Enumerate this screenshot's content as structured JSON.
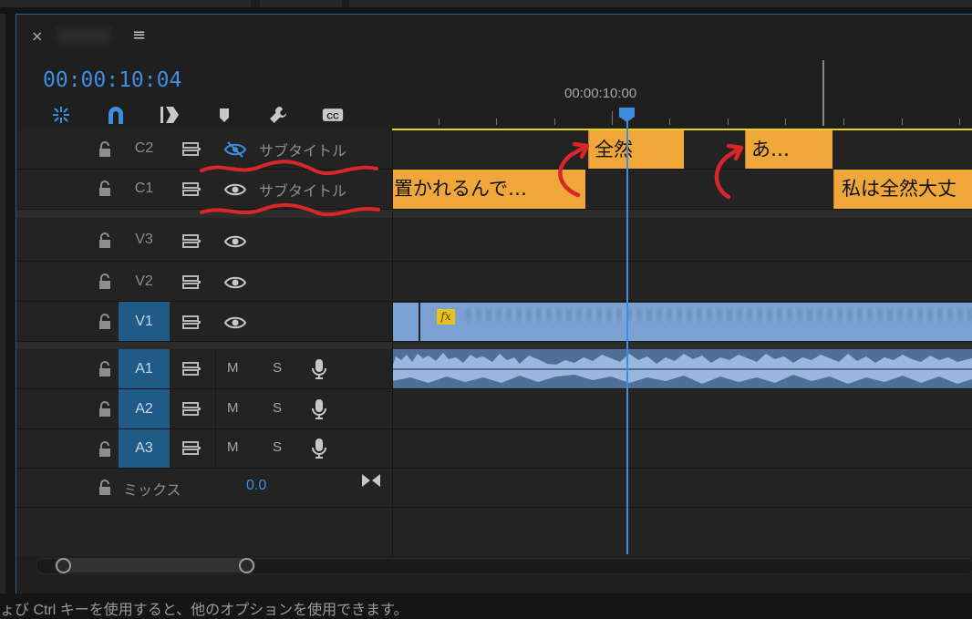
{
  "panel": {
    "close_symbol": "×",
    "menu_symbol": "≡",
    "timecode": "00:00:10:04",
    "ruler_timecode": "00:00:10:00"
  },
  "toolbar": {
    "tools": [
      {
        "icon": "nest-sequence-icon"
      },
      {
        "icon": "snap-magnet-icon"
      },
      {
        "icon": "linked-selection-icon"
      },
      {
        "icon": "add-marker-icon"
      },
      {
        "icon": "wrench-settings-icon"
      },
      {
        "icon": "captions-cc-icon"
      }
    ],
    "cc_label": "CC"
  },
  "tracks": {
    "caption": [
      {
        "name": "C2",
        "label": "サブタイトル",
        "eye_hidden": true
      },
      {
        "name": "C1",
        "label": "サブタイトル",
        "eye_hidden": false
      }
    ],
    "video": [
      {
        "name": "V3",
        "selected": false
      },
      {
        "name": "V2",
        "selected": false
      },
      {
        "name": "V1",
        "selected": true
      }
    ],
    "audio": [
      {
        "name": "A1",
        "m": "M",
        "s": "S"
      },
      {
        "name": "A2",
        "m": "M",
        "s": "S"
      },
      {
        "name": "A3",
        "m": "M",
        "s": "S"
      }
    ],
    "mix": {
      "label": "ミックス",
      "value": "0.0"
    }
  },
  "clips": {
    "c2": [
      {
        "text": "全然"
      },
      {
        "text": "あ…"
      }
    ],
    "c1": [
      {
        "text": "置かれるんで…"
      },
      {
        "text": "私は全然大丈"
      }
    ],
    "v1_fx": "fx"
  },
  "footer": {
    "text": "ょび Ctrl キーを使用すると、他のオプションを使用できます。"
  },
  "colors": {
    "accent": "#3d8ee0",
    "caption_clip": "#f0a73a",
    "video_clip": "#7aa1d2",
    "selected_track": "#1f5b86",
    "annotation": "#d8262a",
    "work_area": "#e6d31e"
  }
}
